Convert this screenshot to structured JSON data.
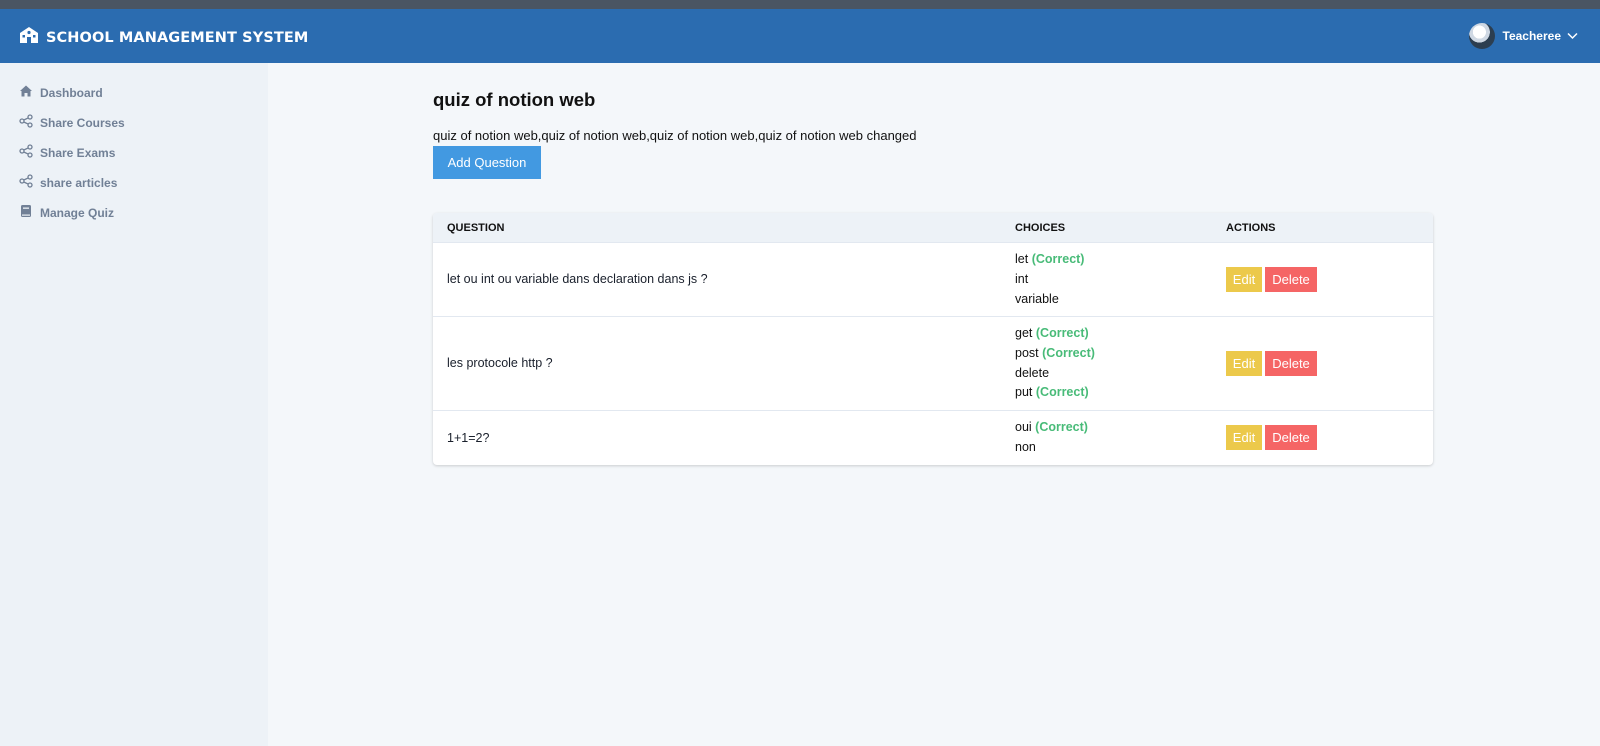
{
  "app": {
    "title": "SCHOOL MANAGEMENT SYSTEM"
  },
  "user": {
    "name": "Teacheree"
  },
  "sidebar": {
    "items": [
      {
        "label": "Dashboard",
        "icon": "home-icon"
      },
      {
        "label": "Share Courses",
        "icon": "share-icon"
      },
      {
        "label": "Share Exams",
        "icon": "share-icon"
      },
      {
        "label": "share articles",
        "icon": "share-icon"
      },
      {
        "label": "Manage Quiz",
        "icon": "book-icon"
      }
    ]
  },
  "quiz": {
    "title": "quiz of notion web",
    "description": "quiz of notion web,quiz of notion web,quiz of notion web,quiz of notion web changed",
    "add_label": "Add Question"
  },
  "table": {
    "headers": {
      "question": "QUESTION",
      "choices": "CHOICES",
      "actions": "ACTIONS"
    },
    "correct_label": "(Correct)",
    "edit_label": "Edit",
    "delete_label": "Delete",
    "rows": [
      {
        "question": "let ou int ou variable dans declaration dans js ?",
        "choices": [
          {
            "text": "let",
            "correct": true
          },
          {
            "text": "int",
            "correct": false
          },
          {
            "text": "variable",
            "correct": false
          }
        ]
      },
      {
        "question": "les protocole http ?",
        "choices": [
          {
            "text": "get",
            "correct": true
          },
          {
            "text": "post",
            "correct": true
          },
          {
            "text": "delete",
            "correct": false
          },
          {
            "text": "put",
            "correct": true
          }
        ]
      },
      {
        "question": "1+1=2?",
        "choices": [
          {
            "text": "oui",
            "correct": true
          },
          {
            "text": "non",
            "correct": false
          }
        ]
      }
    ]
  },
  "colors": {
    "topbar": "#2b6cb0",
    "sidebar": "#edf2f7",
    "primary_button": "#4299e1",
    "edit_button": "#ecc94b",
    "delete_button": "#f56565",
    "correct": "#48bb78"
  }
}
